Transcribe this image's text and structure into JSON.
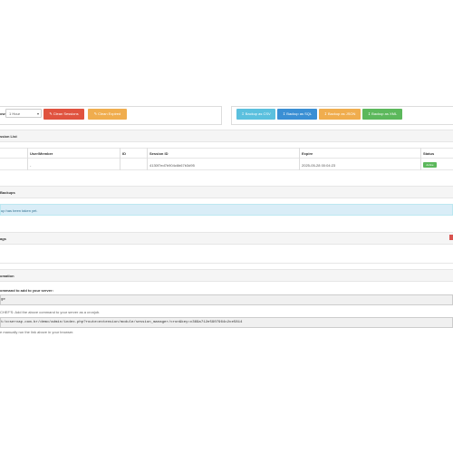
{
  "toolbar": {
    "filter_label": "ow:",
    "filter_select": "1 Hour",
    "clean_sessions": "Clean Sessions",
    "clean_expired": "Clean Expired",
    "backup_csv": "Backup as CSV",
    "backup_sql": "Backup as SQL",
    "backup_json": "Backup as JSON",
    "backup_xml": "Backup as XML"
  },
  "colors": {
    "danger": "#e0533f",
    "warning": "#f0ad4e",
    "info": "#5bc0de",
    "primary": "#3a8fd4",
    "success": "#5cb85c"
  },
  "session_list": {
    "title": "ssion List",
    "columns": [
      "User/Member",
      "ID",
      "Session ID",
      "Expire",
      "Status"
    ],
    "row": {
      "user": "-",
      "id": "",
      "session_id": "4130f7ed7b904c6b67b3d95",
      "expire": "2025-05-28 00:04:23",
      "status": "Active"
    }
  },
  "backup": {
    "title": "Backups",
    "empty_message": "up has been taken yet."
  },
  "logs": {
    "title": "ags"
  },
  "automation": {
    "title": "omation",
    "subtitle": "ommand to add to your server:",
    "code1": "ge",
    "note1": "CHEF'S: Add the above command to your server as a cronjob.",
    "code2": "t/ccservap.com.br/demo/admin/index.php?route=extension/module/session_manager/cron&key=c369a712e5907964c2ce5814",
    "note2": "e manually run the link above in your browser."
  }
}
